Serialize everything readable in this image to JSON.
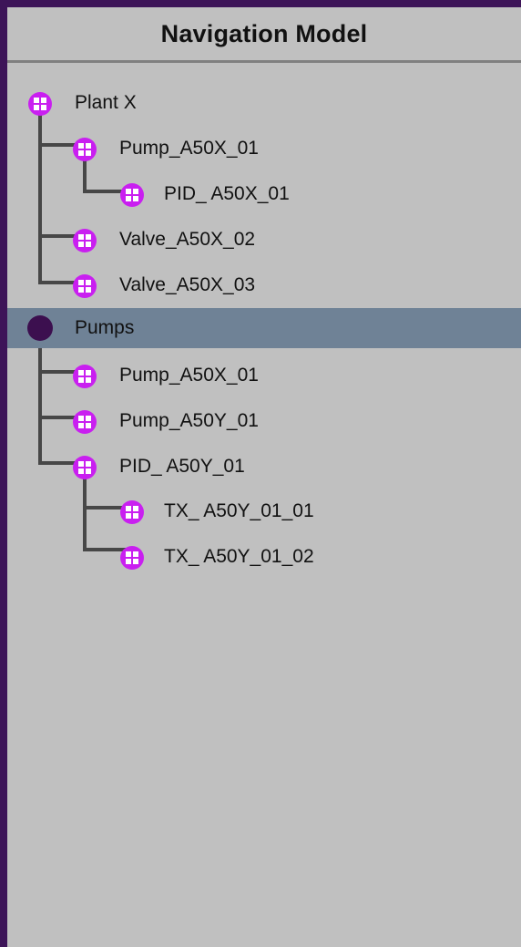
{
  "panel": {
    "title": "Navigation Model"
  },
  "tree": {
    "nodes": [
      {
        "label": "Plant X",
        "level": 0,
        "icon": "model-node-icon"
      },
      {
        "label": "Pump_A50X_01",
        "level": 1,
        "icon": "model-node-icon"
      },
      {
        "label": "PID_ A50X_01",
        "level": 2,
        "icon": "model-node-icon"
      },
      {
        "label": "Valve_A50X_02",
        "level": 1,
        "icon": "model-node-icon"
      },
      {
        "label": "Valve_A50X_03",
        "level": 1,
        "icon": "model-node-icon"
      },
      {
        "label": "Pumps",
        "level": 0,
        "icon": "group-dot-icon",
        "selected": true
      },
      {
        "label": "Pump_A50X_01",
        "level": 1,
        "icon": "model-node-icon"
      },
      {
        "label": "Pump_A50Y_01",
        "level": 1,
        "icon": "model-node-icon"
      },
      {
        "label": "PID_ A50Y_01",
        "level": 1,
        "icon": "model-node-icon"
      },
      {
        "label": "TX_ A50Y_01_01",
        "level": 2,
        "icon": "model-node-icon"
      },
      {
        "label": "TX_ A50Y_01_02",
        "level": 2,
        "icon": "model-node-icon"
      }
    ]
  },
  "colors": {
    "frame": "#3d1458",
    "panel_background": "#c0c0c0",
    "selected_row": "#6f8296",
    "node_icon": "#c91ff0",
    "group_dot": "#3c0f4f",
    "connector": "#474747"
  }
}
